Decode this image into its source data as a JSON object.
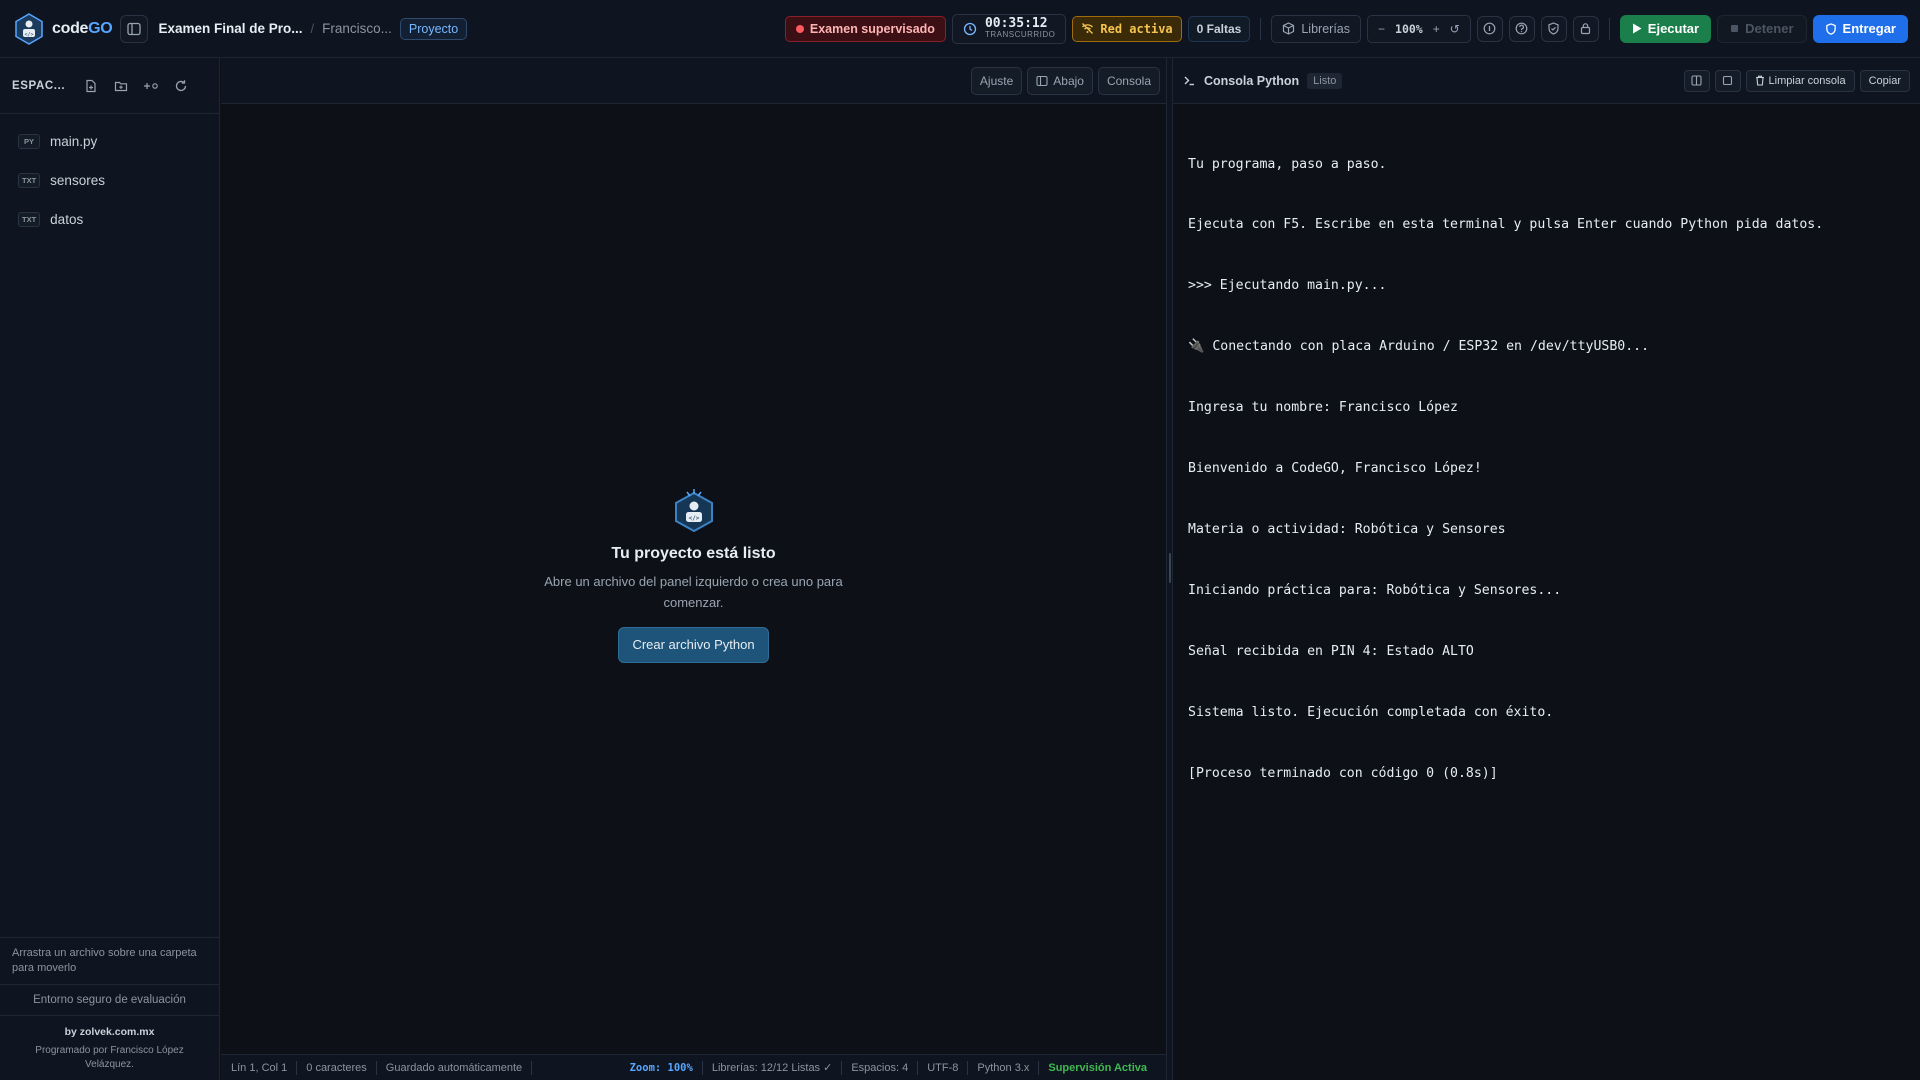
{
  "app": {
    "logo_text": "code",
    "logo_text_accent": "GO",
    "exam_title": "Examen Final de Pro...",
    "student": "Francisco...",
    "mode_tag": "Proyecto"
  },
  "top": {
    "exam_badge": "Examen supervisado",
    "timer_value": "00:35:12",
    "timer_label": "TRANSCURRIDO",
    "network_badge": "Red activa",
    "faults": "0 Faltas",
    "libraries": "Librerías",
    "zoom_minus": "−",
    "zoom_value": "100%",
    "zoom_plus": "+",
    "zoom_reset": "↺",
    "run": "Ejecutar",
    "stop": "Detener",
    "submit": "Entregar"
  },
  "sidebar": {
    "header_label": "ESPAC...",
    "files": [
      {
        "tag": "PY",
        "name": "main.py"
      },
      {
        "tag": "TXT",
        "name": "sensores"
      },
      {
        "tag": "TXT",
        "name": "datos"
      }
    ],
    "drag_hint": "Arrastra un archivo sobre una carpeta para moverlo",
    "secure_env": "Entorno seguro de evaluación",
    "by": "by zolvek.com.mx",
    "programmed_by": "Programado por Francisco López Velázquez."
  },
  "editor": {
    "toolbar": {
      "wrap": "Ajuste",
      "below": "Abajo",
      "console": "Consola"
    },
    "empty_title": "Tu proyecto está listo",
    "empty_desc": "Abre un archivo del panel izquierdo o crea uno para comenzar.",
    "create_button": "Crear archivo Python"
  },
  "statusbar": {
    "position": "Lín 1, Col 1",
    "chars": "0 caracteres",
    "autosave": "Guardado automáticamente",
    "zoom": "Zoom: 100%",
    "libraries": "Librerías: 12/12 Listas ✓",
    "spaces": "Espacios: 4",
    "encoding": "UTF-8",
    "python": "Python 3.x",
    "supervision": "Supervisión Activa"
  },
  "console": {
    "title": "Consola Python",
    "status": "Listo",
    "clear": "Limpiar consola",
    "copy": "Copiar",
    "lines": [
      "Tu programa, paso a paso.",
      "Ejecuta con F5. Escribe en esta terminal y pulsa Enter cuando Python pida datos.",
      ">>> Ejecutando main.py...",
      "🔌 Conectando con placa Arduino / ESP32 en /dev/ttyUSB0...",
      "Ingresa tu nombre: Francisco López",
      "Bienvenido a CodeGO, Francisco López!",
      "Materia o actividad: Robótica y Sensores",
      "Iniciando práctica para: Robótica y Sensores...",
      "Señal recibida en PIN 4: Estado ALTO",
      "Sistema listo. Ejecución completada con éxito.",
      "[Proceso terminado con código 0 (0.8s)]"
    ]
  },
  "colors": {
    "accent": "#58a6ff",
    "run": "#1a7f4b",
    "submit": "#1f6feb",
    "exam": "#ff5a5f",
    "network": "#f5c451",
    "supervision": "#3fb950"
  }
}
